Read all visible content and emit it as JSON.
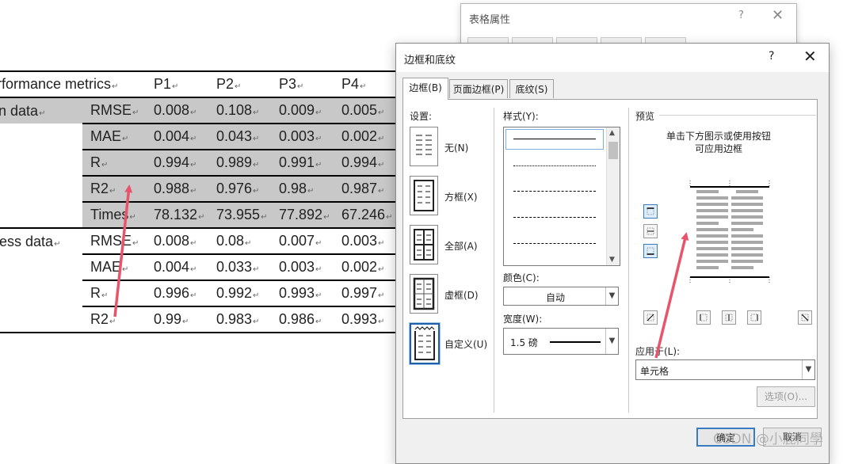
{
  "table": {
    "header": [
      "rformance metrics",
      "P1",
      "P2",
      "P3",
      "P4"
    ],
    "groups": [
      {
        "name": "igin data",
        "rows": [
          {
            "metric": "RMSE",
            "values": [
              "0.008",
              "0.108",
              "0.009",
              "0.005"
            ]
          },
          {
            "metric": "MAE",
            "values": [
              "0.004",
              "0.043",
              "0.003",
              "0.002"
            ]
          },
          {
            "metric": "R",
            "values": [
              "0.994",
              "0.989",
              "0.991",
              "0.994"
            ]
          },
          {
            "metric": "R2",
            "values": [
              "0.988",
              "0.976",
              "0.98",
              "0.987"
            ]
          },
          {
            "metric": "Times",
            "values": [
              "78.132",
              "73.955",
              "77.892",
              "67.246"
            ]
          }
        ]
      },
      {
        "name": "ocess data",
        "rows": [
          {
            "metric": "RMSE",
            "values": [
              "0.008",
              "0.08",
              "0.007",
              "0.003"
            ]
          },
          {
            "metric": "MAE",
            "values": [
              "0.004",
              "0.033",
              "0.003",
              "0.002"
            ]
          },
          {
            "metric": "R",
            "values": [
              "0.996",
              "0.992",
              "0.993",
              "0.997"
            ]
          },
          {
            "metric": "R2",
            "values": [
              "0.99",
              "0.983",
              "0.986",
              "0.993"
            ]
          }
        ]
      }
    ],
    "para_mark": "↵",
    "shade_color": "#c8c8c8"
  },
  "bg_dialog": {
    "title": "表格属性",
    "help": "?",
    "close": "✕"
  },
  "dialog": {
    "title": "边框和底纹",
    "help": "?",
    "close": "✕",
    "tabs": [
      "边框(B)",
      "页面边框(P)",
      "底纹(S)"
    ],
    "settings_label": "设置:",
    "settings": [
      {
        "label": "无(N)",
        "icon": "none-border-icon"
      },
      {
        "label": "方框(X)",
        "icon": "box-border-icon"
      },
      {
        "label": "全部(A)",
        "icon": "all-borders-icon"
      },
      {
        "label": "虚框(D)",
        "icon": "grid-border-icon"
      },
      {
        "label": "自定义(U)",
        "icon": "custom-border-icon"
      }
    ],
    "selected_setting": "自定义(U)",
    "style_label": "样式(Y):",
    "color_label": "颜色(C):",
    "color_value": "自动",
    "width_label": "宽度(W):",
    "width_value": "1.5 磅",
    "preview_label": "预览",
    "preview_hint": "单击下方图示或使用按钮可应用边框",
    "apply_label": "应用于(L):",
    "apply_value": "单元格",
    "options_button": "选项(O)...",
    "ok_button": "确定",
    "cancel_button": "取消"
  },
  "watermark": "CSDN @小鹿同學",
  "colors": {
    "arrow": "#e8556b",
    "accent": "#3a7cc2"
  }
}
